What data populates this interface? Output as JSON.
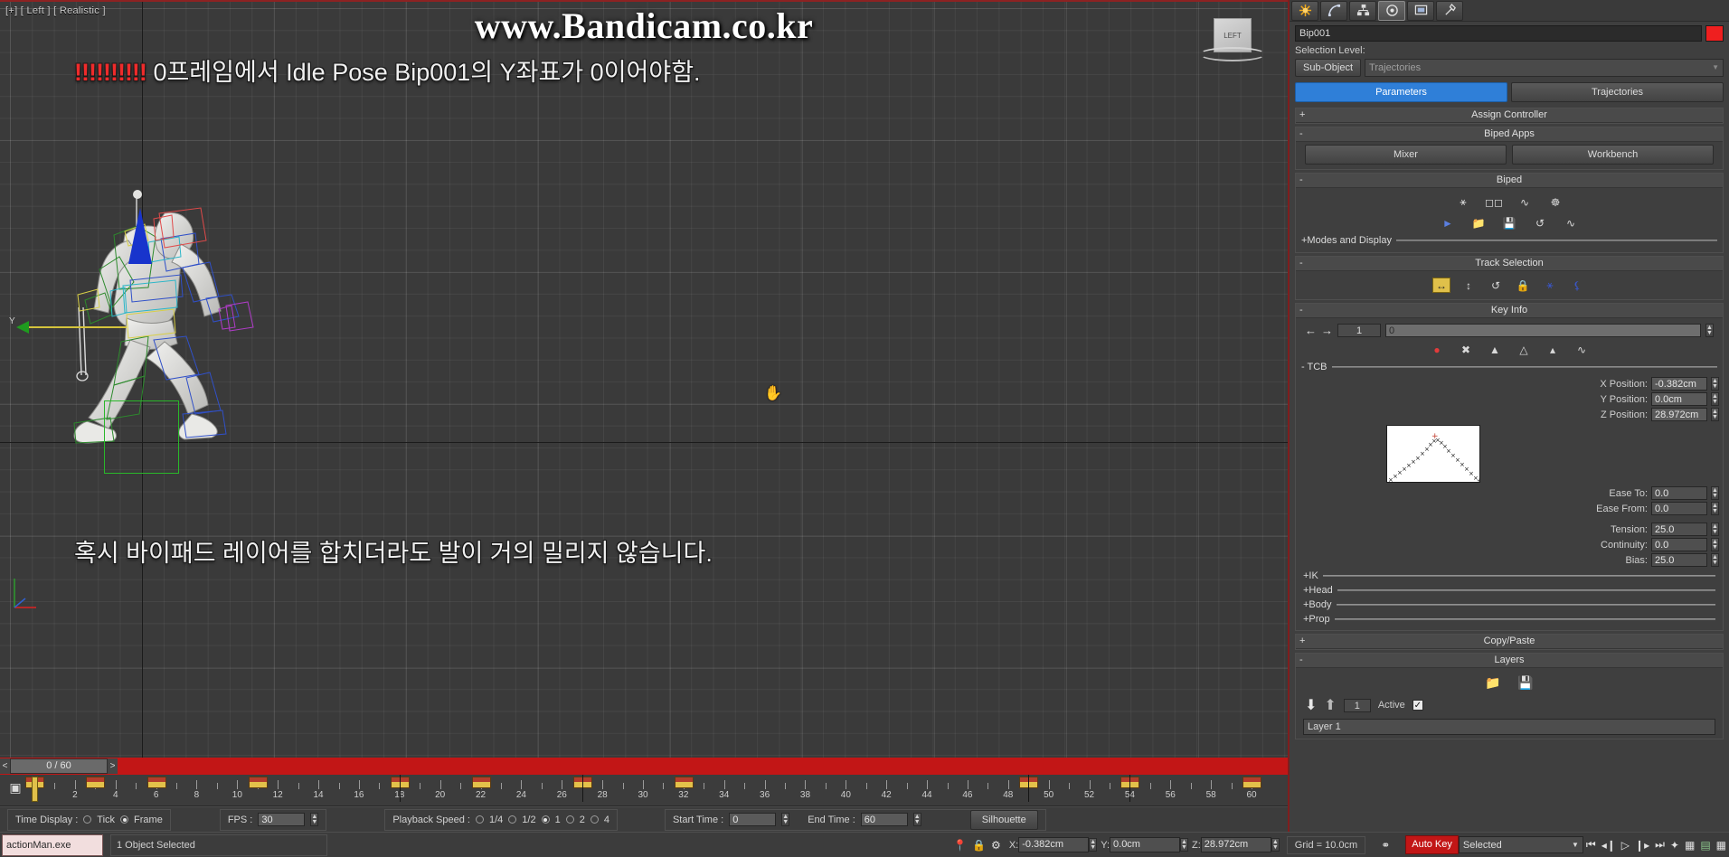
{
  "viewport": {
    "label": "[+] [ Left ] [ Realistic ]",
    "viewcube_label": "LEFT",
    "watermark": "www.Bandicam.co.kr",
    "overlay_top_bangs": "!!!!!!!!!!",
    "overlay_top_text": "0프레임에서 Idle Pose Bip001의 Y좌표가 0이어야함.",
    "overlay_bottom_text": "혹시 바이패드 레이어를 합치더라도 발이 거의 밀리지 않습니다.",
    "axis_label_y": "Y",
    "cursor_icon": "hand-cursor"
  },
  "command_panel": {
    "tabs": [
      {
        "name": "create-tab",
        "icon": "star-icon",
        "active": false
      },
      {
        "name": "modify-tab",
        "icon": "curve-icon",
        "active": false
      },
      {
        "name": "hierarchy-tab",
        "icon": "hierarchy-icon",
        "active": false
      },
      {
        "name": "motion-tab",
        "icon": "wheel-icon",
        "active": true
      },
      {
        "name": "display-tab",
        "icon": "monitor-icon",
        "active": false
      },
      {
        "name": "utilities-tab",
        "icon": "hammer-icon",
        "active": false
      }
    ],
    "object_name": "Bip001",
    "object_color": "#ef1f1f",
    "selection_level_label": "Selection Level:",
    "sub_object_button": "Sub-Object",
    "sub_object_dropdown": "Trajectories",
    "mode_tabs": {
      "parameters": "Parameters",
      "trajectories": "Trajectories"
    },
    "rollouts": {
      "assign_controller": {
        "sign": "+",
        "title": "Assign Controller"
      },
      "biped_apps": {
        "sign": "-",
        "title": "Biped Apps",
        "buttons": [
          "Mixer",
          "Workbench"
        ]
      },
      "biped": {
        "sign": "-",
        "title": "Biped",
        "row1_icons": [
          "figure-mode-icon",
          "footstep-mode-icon",
          "motion-flow-mode-icon",
          "mixer-mode-icon"
        ],
        "row2_icons": [
          "convert-icon",
          "load-file-icon",
          "save-file-icon",
          "satellite-icon",
          "twist-icon"
        ],
        "sub_section": "+Modes and Display"
      },
      "track_selection": {
        "sign": "-",
        "title": "Track Selection",
        "icons": [
          "body-horizontal-icon",
          "body-vertical-icon",
          "body-rotation-icon",
          "lock-com-keying-icon",
          "symmetrical-tracks-icon",
          "opposite-tracks-icon"
        ]
      },
      "key_info": {
        "sign": "-",
        "title": "Key Info",
        "prev_key_icon": "arrow-left-icon",
        "next_key_icon": "arrow-right-icon",
        "key_number": "1",
        "key_time": "0",
        "action_icons": [
          "set-key-icon",
          "delete-key-icon",
          "set-planted-key-icon",
          "set-sliding-key-icon",
          "set-free-key-icon",
          "trajectory-curve-icon"
        ],
        "tcb_label": "- TCB",
        "fields": [
          {
            "label": "X Position:",
            "value": "-0.382cm"
          },
          {
            "label": "Y Position:",
            "value": "0.0cm"
          },
          {
            "label": "Z Position:",
            "value": "28.972cm"
          },
          {
            "label": "Ease To:",
            "value": "0.0"
          },
          {
            "label": "Ease From:",
            "value": "0.0"
          },
          {
            "label": "Tension:",
            "value": "25.0"
          },
          {
            "label": "Continuity:",
            "value": "0.0"
          },
          {
            "label": "Bias:",
            "value": "25.0"
          }
        ],
        "sub_rollouts": [
          "+IK",
          "+Head",
          "+Body",
          "+Prop"
        ]
      },
      "copy_paste": {
        "sign": "+",
        "title": "Copy/Paste"
      },
      "layers": {
        "sign": "-",
        "title": "Layers",
        "icons": [
          "load-layer-icon",
          "save-layer-icon"
        ],
        "down_icon": "arrow-down-icon",
        "up_icon": "arrow-up-icon",
        "layer_index": "1",
        "active_label": "Active",
        "active_checked": true,
        "layer_name": "Layer 1"
      }
    }
  },
  "timeline": {
    "slider_label": "0 / 60",
    "left_arrow": "<",
    "right_arrow": ">",
    "ruler_min": 0,
    "ruler_max": 60,
    "ruler_labels": [
      2,
      4,
      6,
      8,
      10,
      12,
      14,
      16,
      18,
      20,
      22,
      24,
      26,
      28,
      30,
      32,
      34,
      36,
      38,
      40,
      42,
      44,
      46,
      48,
      50,
      52,
      54,
      56,
      58,
      60
    ],
    "key_frames": [
      0,
      3,
      6,
      11,
      18,
      22,
      27,
      32,
      49,
      54,
      60
    ],
    "playhead_frame": 0
  },
  "anim_bar": {
    "time_display_label": "Time Display :",
    "time_display_options": [
      "Tick",
      "Frame"
    ],
    "time_display_selected": "Frame",
    "fps_label": "FPS :",
    "fps_value": "30",
    "playback_speed_label": "Playback Speed :",
    "playback_speed_options": [
      "1/4",
      "1/2",
      "1",
      "2",
      "4"
    ],
    "playback_speed_selected": "1",
    "start_time_label": "Start Time :",
    "start_time_value": "0",
    "end_time_label": "End Time :",
    "end_time_value": "60",
    "silhouette_button": "Silhouette"
  },
  "status_bar": {
    "taskbar_item": "actionMan.exe",
    "status_message": "1 Object Selected",
    "lock_icon": "lock-icon",
    "pin_icon": "pin-icon",
    "absolute_mode_icon": "absolute-mode-icon",
    "coords": [
      {
        "label": "X:",
        "value": "-0.382cm"
      },
      {
        "label": "Y:",
        "value": "0.0cm"
      },
      {
        "label": "Z:",
        "value": "28.972cm"
      }
    ],
    "grid_info": "Grid = 10.0cm",
    "auto_key_label": "Auto Key",
    "key_filter_value": "Selected",
    "playback_icons": [
      "go-to-start-icon",
      "prev-frame-icon",
      "play-icon",
      "next-frame-icon",
      "go-to-end-icon",
      "key-mode-icon",
      "set-key-icon",
      "key-filters-icon"
    ]
  }
}
